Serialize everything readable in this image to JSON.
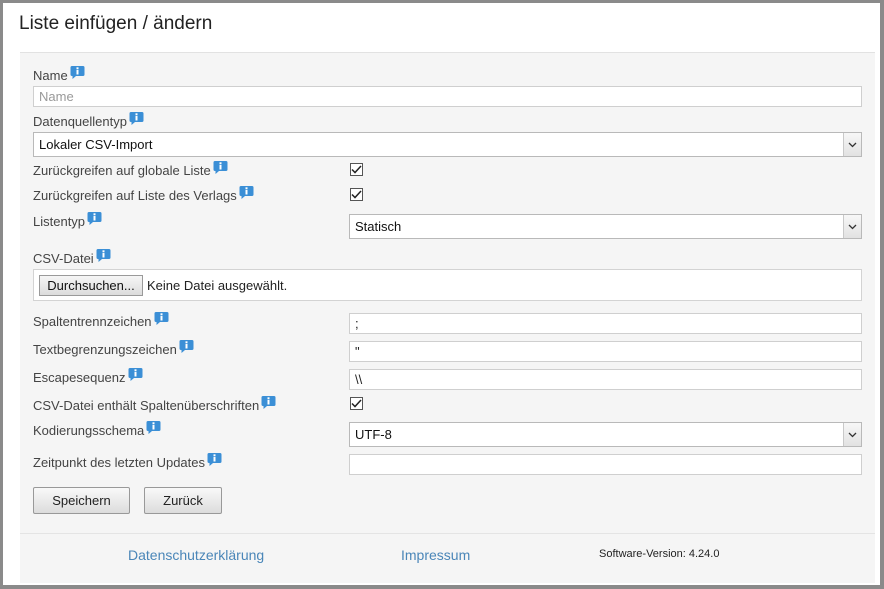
{
  "page": {
    "title": "Liste einfügen / ändern"
  },
  "form": {
    "name_label": "Name",
    "name_placeholder": "Name",
    "source_type_label": "Datenquellentyp",
    "source_type_value": "Lokaler CSV-Import",
    "fallback_global_label": "Zurückgreifen auf globale Liste",
    "fallback_global_checked": true,
    "fallback_publisher_label": "Zurückgreifen auf Liste des Verlags",
    "fallback_publisher_checked": true,
    "list_type_label": "Listentyp",
    "list_type_value": "Statisch",
    "csv_file_label": "CSV-Datei",
    "browse_button": "Durchsuchen...",
    "no_file_text": "Keine Datei ausgewählt.",
    "separator_label": "Spaltentrennzeichen",
    "separator_value": ";",
    "text_delimiter_label": "Textbegrenzungszeichen",
    "text_delimiter_value": "\"",
    "escape_label": "Escapesequenz",
    "escape_value": "\\\\",
    "header_row_label": "CSV-Datei enthält Spaltenüberschriften",
    "header_row_checked": true,
    "encoding_label": "Kodierungsschema",
    "encoding_value": "UTF-8",
    "last_update_label": "Zeitpunkt des letzten Updates",
    "last_update_value": "",
    "save_button": "Speichern",
    "back_button": "Zurück"
  },
  "footer": {
    "privacy_link": "Datenschutzerklärung",
    "imprint_link": "Impressum",
    "version": "Software-Version: 4.24.0"
  },
  "colors": {
    "link": "#4a86b8",
    "panel_bg": "#f5f5f5",
    "info_icon": "#3b8fd6"
  }
}
